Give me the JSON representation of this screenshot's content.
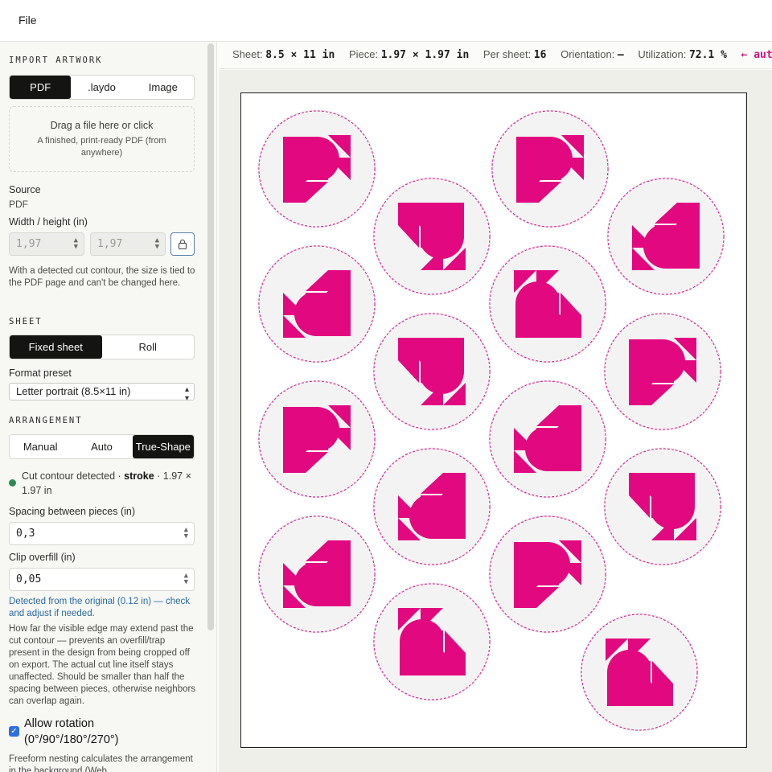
{
  "menubar": {
    "file_label": "File"
  },
  "import": {
    "section_title": "IMPORT ARTWORK",
    "tabs": [
      "PDF",
      ".laydo",
      "Image"
    ],
    "dropzone_title": "Drag a file here or click",
    "dropzone_hint": "A finished, print-ready PDF (from anywhere)",
    "source_label": "Source",
    "source_value": "PDF",
    "size_label": "Width / height (in)",
    "width_value": "1,97",
    "height_value": "1,97",
    "size_note": "With a detected cut contour, the size is tied to the PDF page and can't be changed here."
  },
  "sheet": {
    "section_title": "SHEET",
    "tabs": [
      "Fixed sheet",
      "Roll"
    ],
    "format_label": "Format preset",
    "format_value": "Letter portrait (8.5×11 in)"
  },
  "arrangement": {
    "section_title": "ARRANGEMENT",
    "tabs": [
      "Manual",
      "Auto",
      "True-Shape"
    ],
    "detected_text": "Cut contour detected · ",
    "detected_bold": "stroke",
    "detected_size": " · 1.97 × 1.97 in",
    "spacing_label": "Spacing between pieces (in)",
    "spacing_value": "0,3",
    "overfill_label": "Clip overfill (in)",
    "overfill_value": "0,05",
    "overfill_note": "Detected from the original (0.12 in) — check and adjust if needed.",
    "overfill_help": "How far the visible edge may extend past the cut contour — prevents an overfill/trap present in the design from being cropped off on export. The actual cut line itself stays unaffected. Should be smaller than half the spacing between pieces, otherwise neighbors can overlap again.",
    "rotation_label": "Allow rotation (0°/90°/180°/270°)",
    "rotation_checked": true,
    "freeform_note": "Freeform nesting calculates the arrangement in the background (Web"
  },
  "infobar": {
    "sheet_label": "Sheet:",
    "sheet_value": "8.5 × 11 in",
    "piece_label": "Piece:",
    "piece_value": "1.97 × 1.97 in",
    "per_sheet_label": "Per sheet:",
    "per_sheet_value": "16",
    "orientation_label": "Orientation:",
    "orientation_value": "—",
    "utilization_label": "Utilization:",
    "utilization_value": "72.1 %",
    "auto_label": "← autom"
  },
  "colors": {
    "accent": "#e2087f",
    "sticker_bg": "#f3f3f4",
    "cut_line": "#e2087f",
    "active_tab": "#141412",
    "status_ok": "#2e8b57",
    "link_blue": "#2a6aa6"
  },
  "pieces": [
    {
      "glyph": "P",
      "rotation": 0
    },
    {
      "glyph": "P",
      "rotation": 0
    },
    {
      "glyph": "P",
      "rotation": 90
    },
    {
      "glyph": "P",
      "rotation": 180
    },
    {
      "glyph": "P",
      "rotation": 180
    },
    {
      "glyph": "P",
      "rotation": 270
    },
    {
      "glyph": "P",
      "rotation": 90
    },
    {
      "glyph": "P",
      "rotation": 0
    },
    {
      "glyph": "P",
      "rotation": 0
    },
    {
      "glyph": "P",
      "rotation": 180
    },
    {
      "glyph": "P",
      "rotation": 180
    },
    {
      "glyph": "P",
      "rotation": 90
    },
    {
      "glyph": "P",
      "rotation": 180
    },
    {
      "glyph": "P",
      "rotation": 0
    },
    {
      "glyph": "P",
      "rotation": 270
    },
    {
      "glyph": "P",
      "rotation": 270
    }
  ]
}
